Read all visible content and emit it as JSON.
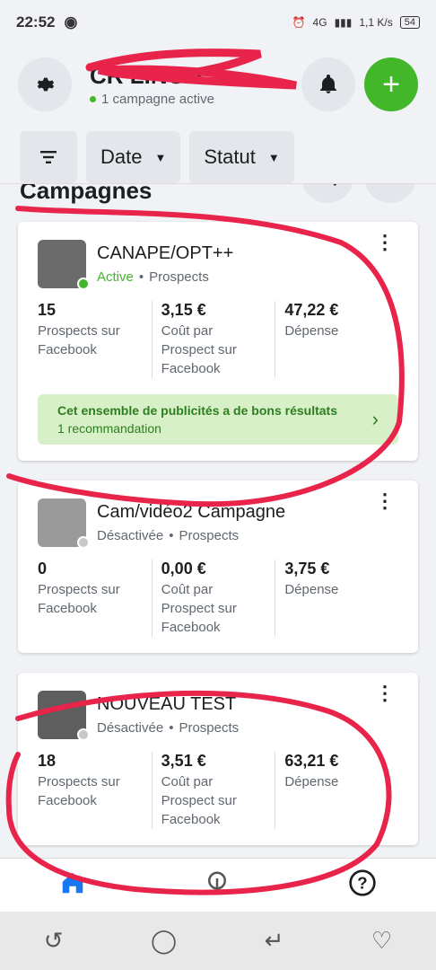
{
  "status_bar": {
    "time": "22:52",
    "network": "4G",
    "speed": "1,1",
    "speed_unit": "K/s",
    "battery": "54"
  },
  "header": {
    "account_name": "CR      LING",
    "account_status": "1 campagne active"
  },
  "filters": {
    "date_label": "Date",
    "status_label": "Statut"
  },
  "section": {
    "title": "Campagnes"
  },
  "campaigns": [
    {
      "name": "CANAPE/OPT++",
      "state": "Active",
      "objective": "Prospects",
      "metrics": [
        {
          "value": "15",
          "label": "Prospects sur Facebook"
        },
        {
          "value": "3,15 €",
          "label": "Coût par Prospect sur Facebook"
        },
        {
          "value": "47,22 €",
          "label": "Dépense"
        }
      ],
      "recommendation": {
        "title": "Cet ensemble de publicités a de bons résultats",
        "subtitle": "1 recommandation"
      }
    },
    {
      "name": "Cam/vidéo2 Campagne",
      "state": "Désactivée",
      "objective": "Prospects",
      "metrics": [
        {
          "value": "0",
          "label": "Prospects sur Facebook"
        },
        {
          "value": "0,00 €",
          "label": "Coût par Prospect sur Facebook"
        },
        {
          "value": "3,75 €",
          "label": "Dépense"
        }
      ]
    },
    {
      "name": "NOUVEAU TEST",
      "state": "Désactivée",
      "objective": "Prospects",
      "metrics": [
        {
          "value": "18",
          "label": "Prospects sur Facebook"
        },
        {
          "value": "3,51 €",
          "label": "Coût par Prospect sur Facebook"
        },
        {
          "value": "63,21 €",
          "label": "Dépense"
        }
      ]
    }
  ],
  "colors": {
    "active_green": "#42b72a",
    "inactive_gray": "#c8c8c8",
    "annotation_red": "#e8244a"
  }
}
